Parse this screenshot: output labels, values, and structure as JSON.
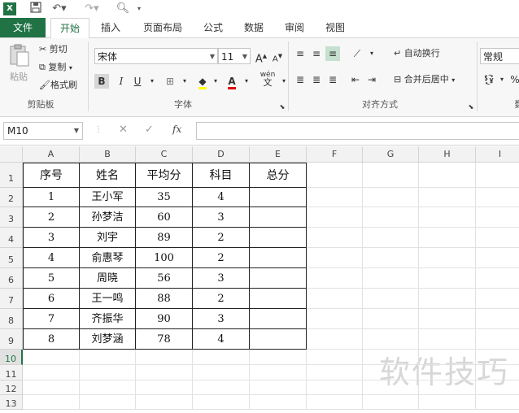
{
  "app": {
    "logo": "X"
  },
  "qat": {
    "save_icon": "save-icon",
    "undo_icon": "undo-icon",
    "redo_icon": "redo-icon",
    "preview_icon": "print-preview-icon"
  },
  "tabs": [
    "文件",
    "开始",
    "插入",
    "页面布局",
    "公式",
    "数据",
    "审阅",
    "视图"
  ],
  "ribbon": {
    "clipboard": {
      "paste": "粘贴",
      "cut": "剪切",
      "copy": "复制",
      "format_painter": "格式刷",
      "label": "剪贴板"
    },
    "font": {
      "name": "宋体",
      "size": "11",
      "bold": "B",
      "italic": "I",
      "underline": "U",
      "label": "字体",
      "grow": "A",
      "shrink": "A",
      "wen": "wén",
      "wen_char": "文"
    },
    "align": {
      "wrap": "自动换行",
      "merge": "合并后居中",
      "label": "对齐方式"
    },
    "number": {
      "format": "常规",
      "label": "数",
      "percent": "%"
    }
  },
  "formula_bar": {
    "name_box": "M10",
    "cancel": "✕",
    "enter": "✓",
    "fx": "fx",
    "value": ""
  },
  "columns": [
    "A",
    "B",
    "C",
    "D",
    "E",
    "F",
    "G",
    "H",
    "I"
  ],
  "rows": [
    "1",
    "2",
    "3",
    "4",
    "5",
    "6",
    "7",
    "8",
    "9",
    "10",
    "11",
    "12",
    "13"
  ],
  "table": {
    "headers": [
      "序号",
      "姓名",
      "平均分",
      "科目",
      "总分"
    ],
    "rows": [
      [
        "1",
        "王小军",
        "35",
        "4",
        ""
      ],
      [
        "2",
        "孙梦洁",
        "60",
        "3",
        ""
      ],
      [
        "3",
        "刘宇",
        "89",
        "2",
        ""
      ],
      [
        "4",
        "俞惠琴",
        "100",
        "2",
        ""
      ],
      [
        "5",
        "周晓",
        "56",
        "3",
        ""
      ],
      [
        "6",
        "王一鸣",
        "88",
        "2",
        ""
      ],
      [
        "7",
        "齐振华",
        "90",
        "3",
        ""
      ],
      [
        "8",
        "刘梦涵",
        "78",
        "4",
        ""
      ]
    ]
  },
  "selected_row": "10",
  "watermark": "软件技巧",
  "colors": {
    "accent": "#217346"
  }
}
